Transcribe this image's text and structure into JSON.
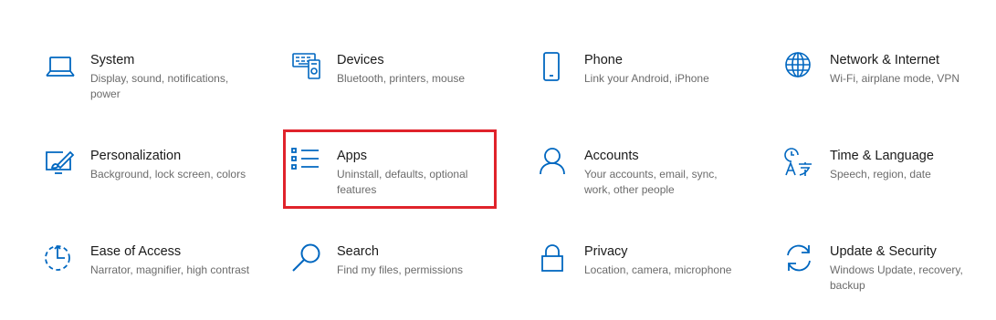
{
  "accent_color": "#0067c0",
  "highlight_color": "#e0232b",
  "tiles": [
    {
      "title": "System",
      "desc": "Display, sound, notifications, power",
      "icon": "laptop-icon"
    },
    {
      "title": "Devices",
      "desc": "Bluetooth, printers, mouse",
      "icon": "devices-icon"
    },
    {
      "title": "Phone",
      "desc": "Link your Android, iPhone",
      "icon": "phone-icon"
    },
    {
      "title": "Network & Internet",
      "desc": "Wi-Fi, airplane mode, VPN",
      "icon": "globe-icon"
    },
    {
      "title": "Personalization",
      "desc": "Background, lock screen, colors",
      "icon": "paint-screen-icon"
    },
    {
      "title": "Apps",
      "desc": "Uninstall, defaults, optional features",
      "icon": "apps-list-icon"
    },
    {
      "title": "Accounts",
      "desc": "Your accounts, email, sync, work, other people",
      "icon": "person-icon"
    },
    {
      "title": "Time & Language",
      "desc": "Speech, region, date",
      "icon": "time-language-icon"
    },
    {
      "title": "Ease of Access",
      "desc": "Narrator, magnifier, high contrast",
      "icon": "ease-of-access-icon"
    },
    {
      "title": "Search",
      "desc": "Find my files, permissions",
      "icon": "search-icon"
    },
    {
      "title": "Privacy",
      "desc": "Location, camera, microphone",
      "icon": "lock-icon"
    },
    {
      "title": "Update & Security",
      "desc": "Windows Update, recovery, backup",
      "icon": "refresh-icon"
    }
  ]
}
